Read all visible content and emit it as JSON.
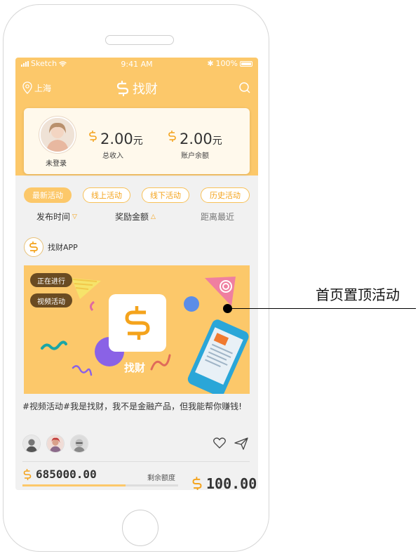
{
  "status_bar": {
    "carrier": "Sketch",
    "time": "9:41 AM",
    "battery": "100%"
  },
  "nav": {
    "location": "上海",
    "app_title": "找财",
    "location_icon": "location-pin-icon",
    "search_icon": "search-icon"
  },
  "profile": {
    "user_label": "未登录",
    "income": {
      "value": "2.00",
      "unit": "元",
      "label": "总收入"
    },
    "balance": {
      "value": "2.00",
      "unit": "元",
      "label": "账户余额"
    }
  },
  "tabs": [
    {
      "label": "最新活动",
      "active": true
    },
    {
      "label": "线上活动",
      "active": false
    },
    {
      "label": "线下活动",
      "active": false
    },
    {
      "label": "历史活动",
      "active": false
    }
  ],
  "sort": [
    {
      "label": "发布时间",
      "indicator": "▽"
    },
    {
      "label": "奖励金额",
      "indicator": "△"
    },
    {
      "label": "距离最近",
      "indicator": ""
    }
  ],
  "post": {
    "author": "找财APP",
    "badges": [
      "正在进行",
      "视频活动"
    ],
    "banner_label": "找财",
    "text": "#视频活动#我是找财，我不是金融产品，但我能帮你赚钱!",
    "amount": "685000.00",
    "remaining_label": "剩余额度",
    "remaining_fraction": 0.66,
    "reward": "100.00"
  },
  "annotation": {
    "label": "首页置顶活动"
  },
  "colors": {
    "brand": "#fcc86a",
    "accent": "#f4a31c",
    "card_bg": "#fff9ec"
  }
}
